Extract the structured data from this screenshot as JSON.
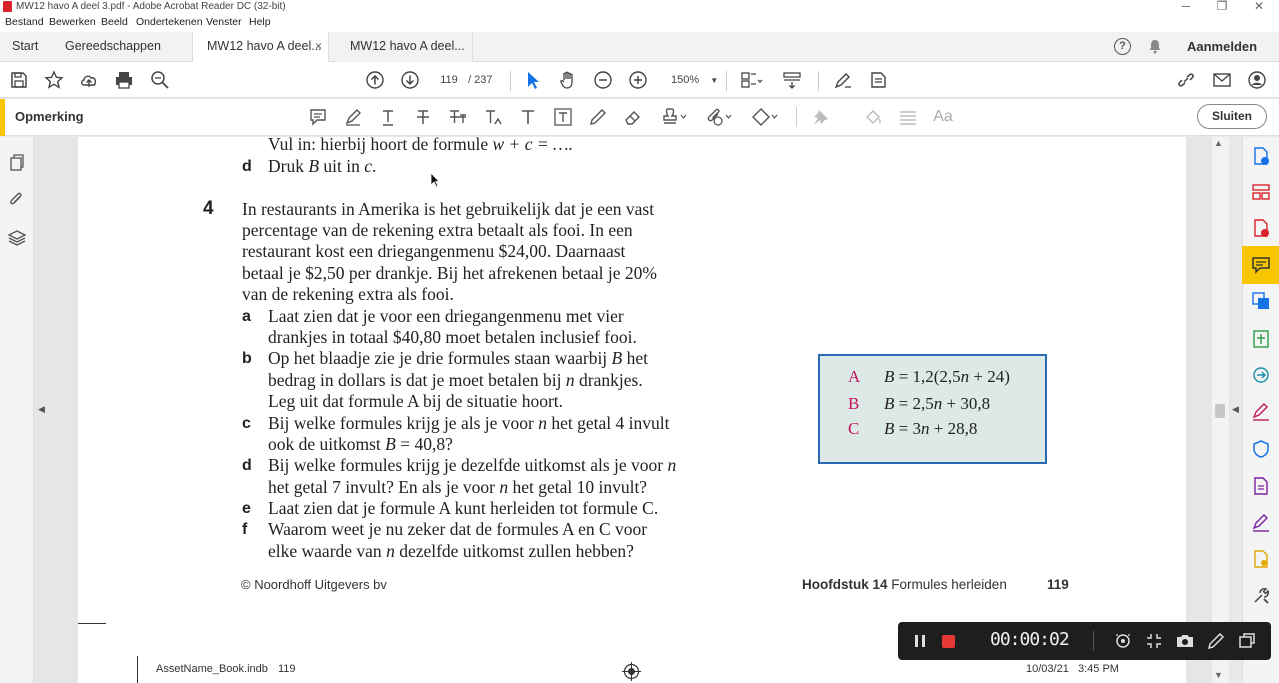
{
  "window": {
    "title": "MW12 havo A deel 3.pdf - Adobe Acrobat Reader DC (32-bit)"
  },
  "menu": [
    "Bestand",
    "Bewerken",
    "Beeld",
    "Ondertekenen",
    "Venster",
    "Help"
  ],
  "tabs": {
    "home": "Start",
    "tools": "Gereedschappen",
    "doc1": "MW12 havo A deel...",
    "doc2": "MW12 havo A deel...",
    "close_symbol": "×",
    "signin": "Aanmelden",
    "help_symbol": "?"
  },
  "toolbar": {
    "page_current": "119",
    "page_total": "/ 237",
    "zoom": "150%"
  },
  "comment_bar": {
    "label": "Opmerking",
    "close": "Sluiten",
    "aa": "Aa"
  },
  "page": {
    "prev_line": "Vul in: hierbij hoort de formule ",
    "prev_formula": "w + c = ….",
    "prev_d_letter": "d",
    "prev_d_text_1": "Druk ",
    "prev_d_var_B": "B",
    "prev_d_text_2": " uit in ",
    "prev_d_var_c": "c",
    "prev_d_text_3": ".",
    "q_number": "4",
    "intro": [
      "In restaurants in Amerika is het gebruikelijk dat je een vast",
      "percentage van de rekening extra betaalt als fooi. In een",
      "restaurant kost een driegangenmenu $24,00. Daarnaast",
      "betaal je $2,50 per drankje. Bij het afrekenen betaal je 20%",
      "van de rekening extra als fooi."
    ],
    "a_letter": "a",
    "a_lines": [
      "Laat zien dat je voor een driegangenmenu met vier",
      "drankjes in totaal $40,80 moet betalen inclusief fooi."
    ],
    "b_letter": "b",
    "b_l1_1": "Op het blaadje zie je drie formules staan waarbij ",
    "b_l1_var": "B",
    "b_l1_2": " het",
    "b_l2_1": "bedrag in dollars is dat je moet betalen bij ",
    "b_l2_var": "n",
    "b_l2_2": " drankjes.",
    "b_l3": "Leg uit dat formule A bij de situatie hoort.",
    "c_letter": "c",
    "c_l1_1": "Bij welke formules krijg je als je voor ",
    "c_l1_var": "n",
    "c_l1_2": " het getal 4 invult",
    "c_l2_1": "ook de uitkomst ",
    "c_l2_var": "B",
    "c_l2_2": " = 40,8?",
    "d_letter": "d",
    "d_l1_1": "Bij welke formules krijg je dezelfde uitkomst als je voor ",
    "d_l1_var": "n",
    "d_l2_1": "het getal 7 invult? En als je voor ",
    "d_l2_var": "n",
    "d_l2_2": " het getal 10 invult?",
    "e_letter": "e",
    "e_text": "Laat zien dat je formule A kunt herleiden tot formule C.",
    "f_letter": "f",
    "f_l1": "Waarom weet je nu zeker dat de formules A en C voor",
    "f_l2_1": "elke waarde van ",
    "f_l2_var": "n",
    "f_l2_2": " dezelfde uitkomst zullen hebben?",
    "formulas": [
      {
        "label": "A",
        "var": "B",
        "expr_1": " = 1,2(2,5",
        "expr_var": "n",
        "expr_2": " + 24)"
      },
      {
        "label": "B",
        "var": "B",
        "expr_1": " = 2,5",
        "expr_var": "n",
        "expr_2": " + 30,8"
      },
      {
        "label": "C",
        "var": "B",
        "expr_1": " = 3",
        "expr_var": "n",
        "expr_2": " + 28,8"
      }
    ],
    "footer_left": "© Noordhoff Uitgevers bv",
    "footer_chapter": "Hoofdstuk 14",
    "footer_title": " Formules herleiden",
    "footer_page": "119",
    "slug_file": "AssetName_Book.indb",
    "slug_page": "119",
    "slug_date": "10/03/21",
    "slug_time": "3:45 PM"
  },
  "recorder": {
    "time": "00:00:02"
  },
  "colors": {
    "accent_yellow": "#f7c600",
    "formula_border": "#2a6bb3",
    "formula_bg": "#dde9e6",
    "formula_label": "#c2185b",
    "record_red": "#e53935"
  }
}
